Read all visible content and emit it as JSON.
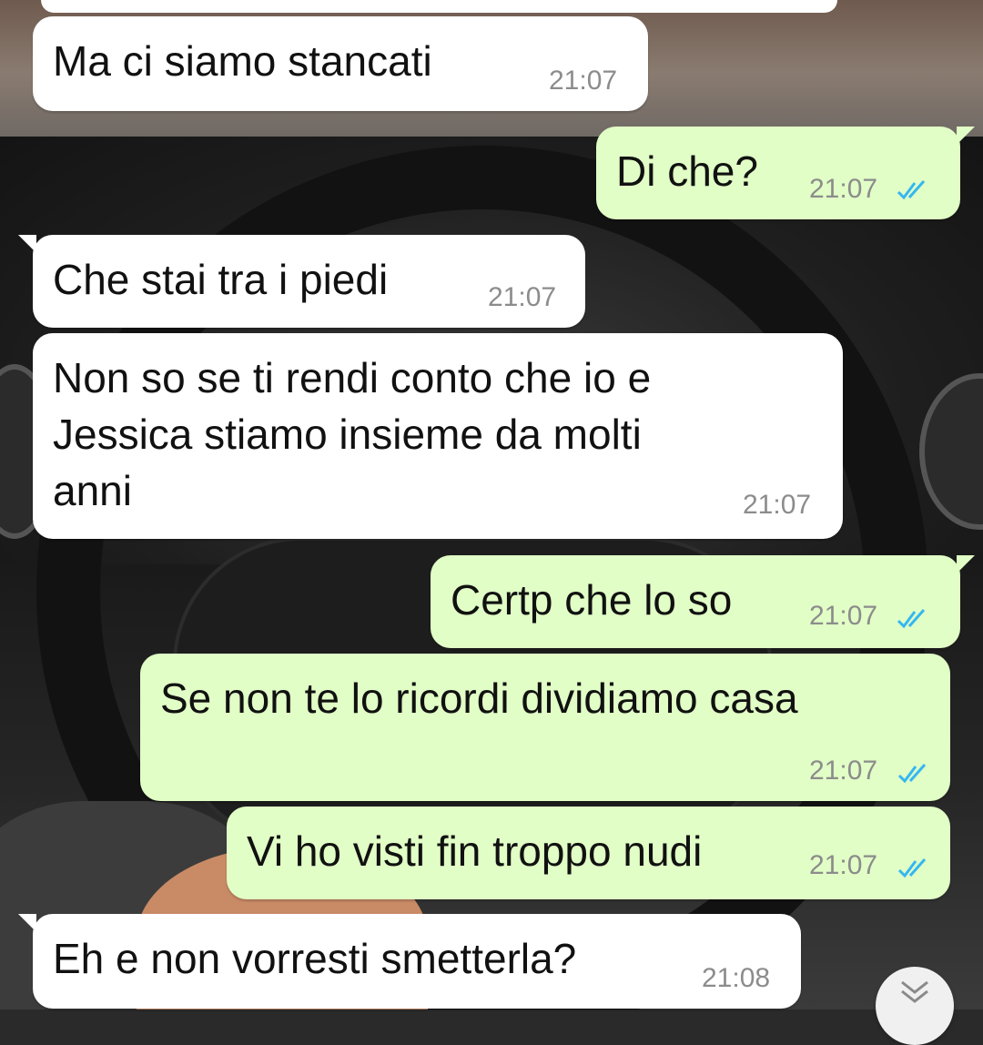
{
  "messages": [
    {
      "direction": "in",
      "text": "Ma ci siamo stancati",
      "time": "21:07"
    },
    {
      "direction": "out",
      "text": "Di che?",
      "time": "21:07",
      "status": "read"
    },
    {
      "direction": "in",
      "text": "Che stai tra i piedi",
      "time": "21:07"
    },
    {
      "direction": "in",
      "text": "Non so se ti rendi conto che io e\nJessica stiamo insieme da molti\nanni",
      "time": "21:07"
    },
    {
      "direction": "out",
      "text": "Certp che lo so",
      "time": "21:07",
      "status": "read"
    },
    {
      "direction": "out",
      "text": "Se non te lo ricordi dividiamo casa",
      "time": "21:07",
      "status": "read"
    },
    {
      "direction": "out",
      "text": "Vi ho visti fin troppo nudi",
      "time": "21:07",
      "status": "read"
    },
    {
      "direction": "in",
      "text": "Eh e non vorresti smetterla?",
      "time": "21:08"
    }
  ],
  "colors": {
    "incoming_bubble": "#ffffff",
    "outgoing_bubble": "#e1fec6",
    "timestamp": "#8c8c8c",
    "read_tick": "#34b7f1"
  },
  "icons": {
    "read_receipt": "double-check-icon",
    "scroll_down": "chevron-double-down-icon"
  }
}
